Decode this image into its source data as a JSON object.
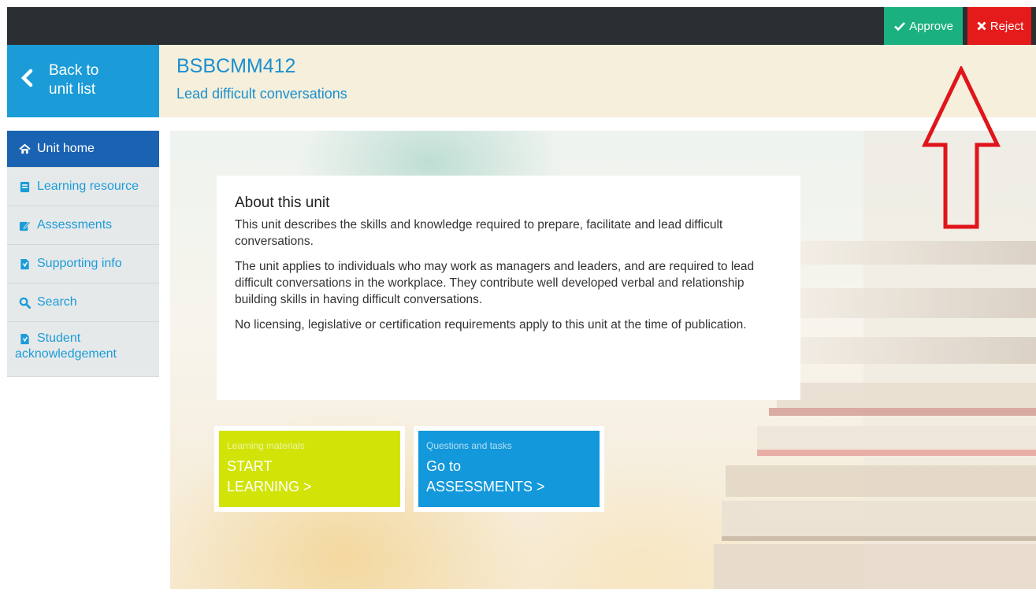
{
  "topbar": {
    "approve_label": "Approve",
    "reject_label": "Reject",
    "approve_color": "#1bb07f",
    "reject_color": "#e51a1a"
  },
  "back": {
    "line1": "Back to",
    "line2": "unit list"
  },
  "unit": {
    "code": "BSBCMM412",
    "name": "Lead difficult conversations"
  },
  "sidebar": {
    "items": [
      {
        "label": "Unit home",
        "icon": "home-icon",
        "active": true
      },
      {
        "label": "Learning resource",
        "icon": "book-icon"
      },
      {
        "label": "Assessments",
        "icon": "edit-icon"
      },
      {
        "label": "Supporting info",
        "icon": "document-icon"
      },
      {
        "label": "Search",
        "icon": "search-icon"
      },
      {
        "label_line1": "Student",
        "label_line2": "acknowledgement",
        "icon": "document-icon"
      }
    ]
  },
  "about": {
    "title": "About this unit",
    "paragraphs": [
      "This unit describes the skills and knowledge required to prepare, facilitate and lead difficult conversations.",
      "The unit applies to individuals who may work as managers and leaders, and are required to lead difficult conversations in the workplace. They contribute well developed verbal and relationship building skills in having difficult conversations.",
      "No licensing, legislative or certification requirements apply to this unit at the time of publication."
    ]
  },
  "cta": {
    "learning": {
      "small": "Learning materials",
      "line1": "START",
      "line2": "LEARNING >",
      "color": "#d2e308"
    },
    "assessments": {
      "small": "Questions and tasks",
      "line1": "Go to",
      "line2": "ASSESSMENTS >",
      "color": "#1398db"
    }
  },
  "colors": {
    "header_bg": "#f5efdc",
    "accent_blue": "#1b9cd8",
    "active_nav": "#1a62b2",
    "annotation_arrow": "#e0151b"
  }
}
